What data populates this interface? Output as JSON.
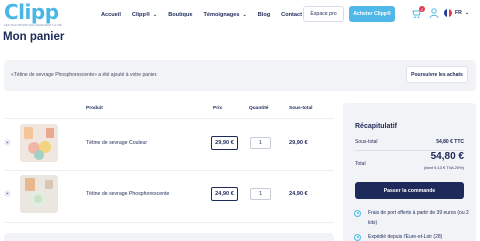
{
  "header": {
    "logo_text": "Clipp",
    "logo_subtitle": "LES SOLUTIONS QUI CHANGENT LA VIE",
    "nav": [
      {
        "label": "Accueil",
        "dropdown": false
      },
      {
        "label": "Clipp®",
        "dropdown": true
      },
      {
        "label": "Boutique",
        "dropdown": false
      },
      {
        "label": "Témoignages",
        "dropdown": true
      },
      {
        "label": "Blog",
        "dropdown": false
      },
      {
        "label": "Contact",
        "dropdown": false
      }
    ],
    "pro_button": "Espace pro",
    "buy_button": "Acheter Clipp®",
    "cart_count": "2",
    "language": "FR"
  },
  "page_title": "Mon panier",
  "notice": {
    "message": "«Tétine de sevrage Phosphorescente» a été ajouté à votre panier.",
    "continue_button": "Poursuivre les achats"
  },
  "table": {
    "headers": {
      "product": "Produit",
      "price": "Prix",
      "quantity": "Quantité",
      "subtotal": "Sous-total"
    },
    "rows": [
      {
        "name": "Tétine de sevrage Couleur",
        "price": "29,90 €",
        "quantity": "1",
        "subtotal": "29,90 €",
        "remove": "×"
      },
      {
        "name": "Tétine de sevrage Phosphorescente",
        "price": "24,90 €",
        "quantity": "1",
        "subtotal": "24,90 €",
        "remove": "×"
      }
    ]
  },
  "summary": {
    "title": "Récapitulatif",
    "subtotal_label": "Sous-total",
    "subtotal_value": "54,80 € TTC",
    "total_label": "Total",
    "total_value": "54,80 €",
    "tax_note": "(dont 9,13 € TVA 20%)",
    "order_button": "Passer la commande",
    "info": [
      {
        "text": "Frais de port offerts à partir de 39 euros (ou 2 kits)",
        "icon": "truck-icon"
      },
      {
        "text": "Expédié depuis l'Eure-et-Loir (28)",
        "icon": "location-icon"
      }
    ]
  },
  "colors": {
    "brand_blue": "#4fb8e8",
    "navy": "#1e2a5a",
    "panel_grey": "#f2f3f7",
    "badge_red": "#e53950"
  }
}
